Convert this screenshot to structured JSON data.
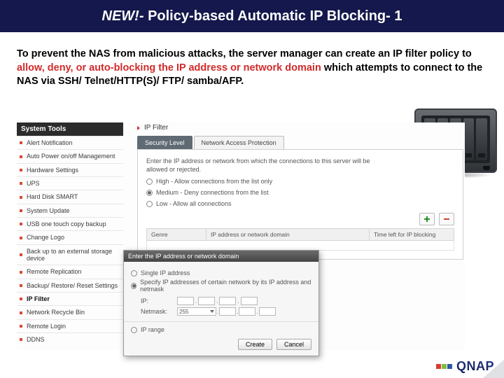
{
  "title": {
    "prefix": "NEW!- ",
    "main": "Policy-based Automatic IP Blocking- 1"
  },
  "intro": {
    "p1": "To prevent the NAS from malicious attacks, the server manager can create an IP filter policy to ",
    "hl": "allow, deny, or auto-blocking the IP address or network domain",
    "p2": " which attempts to connect to the NAS via SSH/ Telnet/HTTP(S)/ FTP/ samba/AFP."
  },
  "sidebar": {
    "header": "System Tools",
    "items": [
      "Alert Notification",
      "Auto Power on/off Management",
      "Hardware Settings",
      "UPS",
      "Hard Disk SMART",
      "System Update",
      "USB one touch copy backup",
      "Change Logo",
      "Back up to an external storage device",
      "Remote Replication",
      "Backup/ Restore/ Reset Settings",
      "IP Filter",
      "Network Recycle Bin",
      "Remote Login",
      "DDNS"
    ],
    "active_index": 11
  },
  "panel": {
    "title": "IP Filter",
    "tabs": [
      {
        "label": "Security Level",
        "active": true
      },
      {
        "label": "Network Access Protection",
        "active": false
      }
    ],
    "hint": "Enter the IP address or network from which the connections to this server will be allowed or rejected.",
    "levels": [
      {
        "label": "High - Allow connections from the list only",
        "selected": false
      },
      {
        "label": "Medium - Deny connections from the list",
        "selected": true
      },
      {
        "label": "Low - Allow all connections",
        "selected": false
      }
    ],
    "columns": [
      "Genre",
      "IP address or network domain",
      "Time left for IP blocking"
    ]
  },
  "dialog": {
    "title": "Enter the IP address or network domain",
    "opts": [
      {
        "label": "Single IP address",
        "selected": false
      },
      {
        "label": "Specify IP addresses of certain network by its IP address and netmask",
        "selected": true
      },
      {
        "label": "IP range",
        "selected": false
      }
    ],
    "fields": {
      "ip_label": "IP:",
      "netmask_label": "Netmask:",
      "netmask_value": "255"
    },
    "buttons": {
      "create": "Create",
      "cancel": "Cancel"
    }
  },
  "brand": {
    "name": "QNAP",
    "colors": [
      "#d53d2e",
      "#7fbf3f",
      "#2e5aa8"
    ]
  }
}
